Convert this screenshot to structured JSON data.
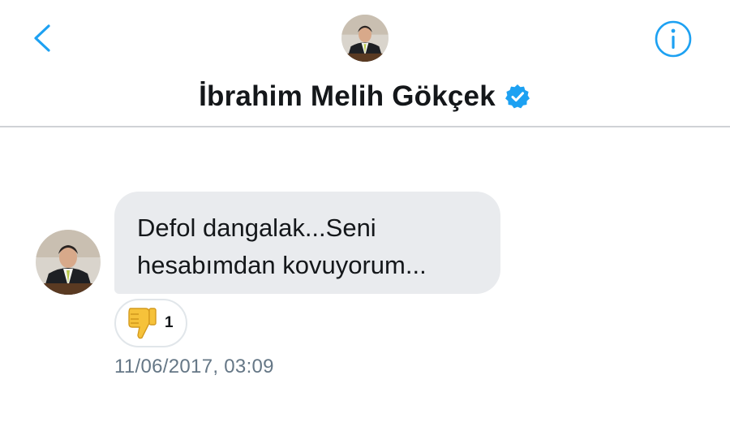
{
  "header": {
    "back_icon": "chevron-left-icon",
    "info_icon": "info-circle-icon",
    "contact_name": "İbrahim Melih Gökçek",
    "verified_icon": "verified-badge-icon",
    "accent_color": "#1da1f2"
  },
  "conversation": {
    "messages": [
      {
        "text": "Defol dangalak...Seni\nhesabımdan kovuyorum...",
        "reaction": {
          "icon": "thumbs-down-emoji",
          "count": "1"
        },
        "timestamp": "11/06/2017, 03:09"
      }
    ]
  }
}
